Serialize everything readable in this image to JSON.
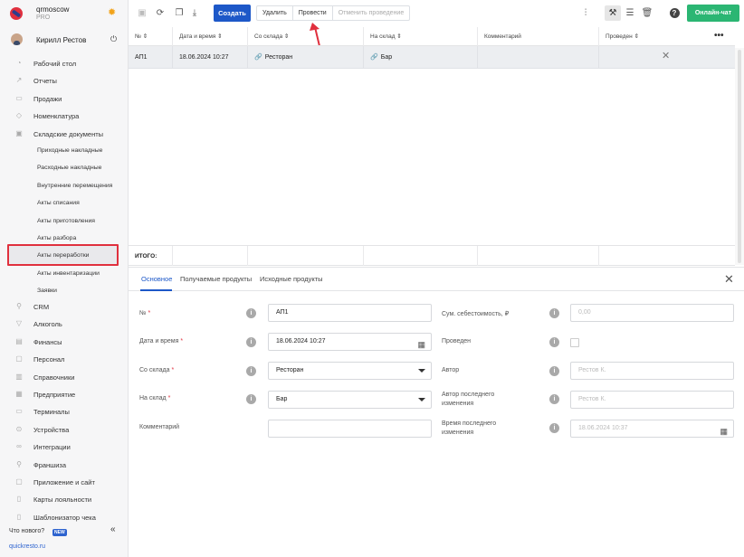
{
  "account": {
    "name": "qrmoscow",
    "plan": "PRO"
  },
  "user": {
    "name": "Кирилл Рестов"
  },
  "nav": [
    {
      "label": "Рабочий стол",
      "icon": "dashboard-icon",
      "glyph": "◔"
    },
    {
      "label": "Отчеты",
      "icon": "reports-icon",
      "glyph": "↗"
    },
    {
      "label": "Продажи",
      "icon": "sales-icon",
      "glyph": "▭"
    },
    {
      "label": "Номенклатура",
      "icon": "tag-icon",
      "glyph": "◇"
    },
    {
      "label": "Складские документы",
      "icon": "box-icon",
      "glyph": "▣"
    }
  ],
  "subnav": [
    "Приходные накладные",
    "Расходные накладные",
    "Внутренние перемещения",
    "Акты списания",
    "Акты приготовления",
    "Акты разбора",
    "Акты переработки",
    "Акты инвентаризации",
    "Заявки"
  ],
  "nav2": [
    {
      "label": "CRM",
      "icon": "crm-icon",
      "glyph": "⚲"
    },
    {
      "label": "Алкоголь",
      "icon": "alcohol-icon",
      "glyph": "▽"
    },
    {
      "label": "Финансы",
      "icon": "finance-icon",
      "glyph": "▤"
    },
    {
      "label": "Персонал",
      "icon": "staff-icon",
      "glyph": "▢"
    },
    {
      "label": "Справочники",
      "icon": "book-icon",
      "glyph": "▥"
    },
    {
      "label": "Предприятие",
      "icon": "company-icon",
      "glyph": "▦"
    },
    {
      "label": "Терминалы",
      "icon": "terminal-icon",
      "glyph": "▭"
    },
    {
      "label": "Устройства",
      "icon": "device-icon",
      "glyph": "⊙"
    },
    {
      "label": "Интеграции",
      "icon": "integration-icon",
      "glyph": "∞"
    },
    {
      "label": "Франшиза",
      "icon": "franchise-icon",
      "glyph": "⚲"
    },
    {
      "label": "Приложение и сайт",
      "icon": "app-icon",
      "glyph": "▢"
    },
    {
      "label": "Карты лояльности",
      "icon": "card-icon",
      "glyph": "▯"
    },
    {
      "label": "Шаблонизатор чека",
      "icon": "receipt-icon",
      "glyph": "▯"
    }
  ],
  "footer": {
    "whats_new": "Что нового?",
    "badge": "NEW",
    "site": "quickresto.ru"
  },
  "toolbar": {
    "create": "Создать",
    "delete": "Удалить",
    "post": "Провести",
    "unpost": "Отменить проведение",
    "chat": "Онлайн-чат"
  },
  "grid": {
    "columns": [
      "№",
      "Дата и время",
      "Со склада",
      "На склад",
      "Комментарий",
      "Проведен"
    ],
    "row": {
      "num": "АП1",
      "datetime": "18.06.2024 10:27",
      "from": "Ресторан",
      "to": "Бар",
      "comment": ""
    },
    "total_label": "ИТОГО:"
  },
  "tabs": [
    "Основное",
    "Получаемые продукты",
    "Исходные продукты"
  ],
  "form": {
    "num_label": "№",
    "num": "АП1",
    "datetime_label": "Дата и время",
    "datetime": "18.06.2024 10:27",
    "from_label": "Со склада",
    "from": "Ресторан",
    "to_label": "На склад",
    "to": "Бар",
    "comment_label": "Комментарий",
    "comment": "",
    "cost_label": "Сум. себестоимость, ₽",
    "cost": "0,00",
    "posted_label": "Проведен",
    "author_label": "Автор",
    "author": "Рестов К.",
    "last_author_label": "Автор последнего изменения",
    "last_author": "Рестов К.",
    "last_time_label": "Время последнего изменения",
    "last_time": "18.06.2024 10:37"
  },
  "colors": {
    "accent": "#1d58c8",
    "chat": "#2bb673",
    "highlight": "#e0303e"
  }
}
